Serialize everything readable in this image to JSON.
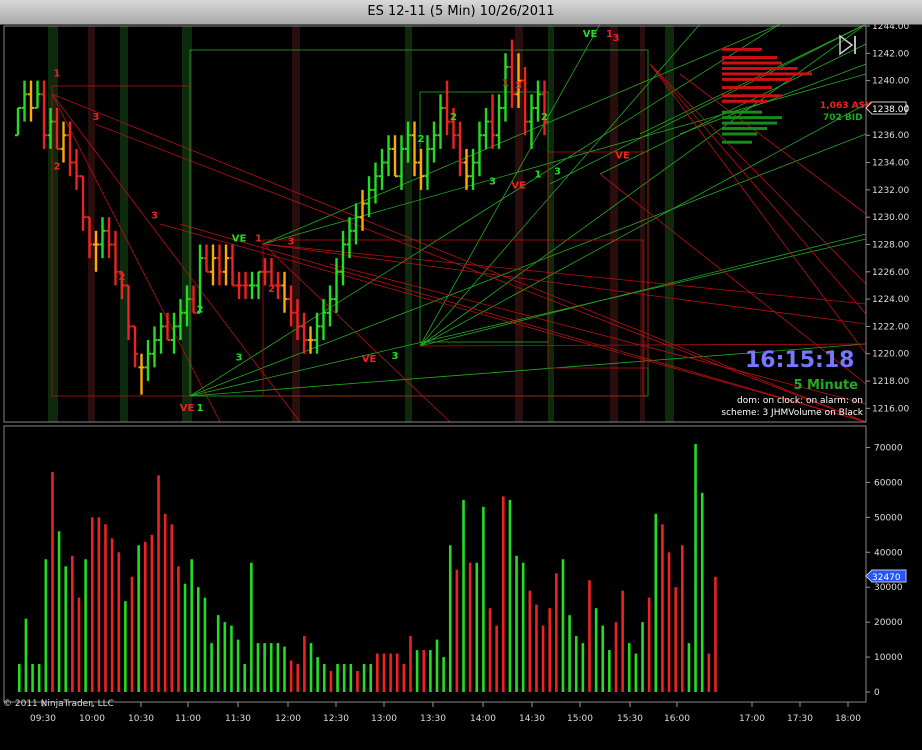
{
  "window": {
    "title": "ES 12-11 (5 Min)  10/26/2011"
  },
  "copyright": "© 2011 NinjaTrader, LLC",
  "clock": {
    "time": "16:15:18",
    "period": "5 Minute"
  },
  "status_lines": [
    "dom: on clock: on alarm: on",
    "scheme: 3 JHMVolume on Black"
  ],
  "dom_labels": {
    "ask": "1,063 ASK",
    "bid": "702 BID"
  },
  "last_price": "1238.00",
  "last_volume": "32470",
  "colors": {
    "up": "#22dd22",
    "down": "#ee2222",
    "neutral": "#ffaa00",
    "background": "#000000",
    "label_last": "#2255ff"
  },
  "chart_data": [
    {
      "type": "candlestick",
      "title": "ES 12-11 (5 Min)  10/26/2011",
      "ylim": [
        1215,
        1244
      ],
      "y_ticks": [
        "1244.00",
        "1242.00",
        "1240.00",
        "1238.00",
        "1236.00",
        "1234.00",
        "1232.00",
        "1230.00",
        "1228.00",
        "1226.00",
        "1224.00",
        "1222.00",
        "1220.00",
        "1218.00",
        "1216.00"
      ],
      "x_ticks": [
        "09:30",
        "10:00",
        "10:30",
        "11:00",
        "11:30",
        "12:00",
        "12:30",
        "13:00",
        "13:30",
        "14:00",
        "14:30",
        "15:00",
        "15:30",
        "16:00",
        "17:00",
        "17:30",
        "18:00"
      ],
      "bars": [
        [
          1236,
          1238,
          1236,
          1238,
          "up"
        ],
        [
          1238,
          1240,
          1237,
          1239,
          "up"
        ],
        [
          1239,
          1240,
          1237,
          1238,
          "neutral"
        ],
        [
          1238,
          1240,
          1238,
          1239,
          "up"
        ],
        [
          1239,
          1240,
          1235,
          1236,
          "down"
        ],
        [
          1236,
          1238,
          1235,
          1237,
          "up"
        ],
        [
          1237,
          1238,
          1235,
          1235,
          "down"
        ],
        [
          1235,
          1237,
          1234,
          1236,
          "neutral"
        ],
        [
          1236,
          1237,
          1233,
          1234,
          "down"
        ],
        [
          1234,
          1235,
          1232,
          1233,
          "down"
        ],
        [
          1233,
          1233,
          1229,
          1230,
          "down"
        ],
        [
          1230,
          1230,
          1227,
          1228,
          "down"
        ],
        [
          1228,
          1229,
          1226,
          1228,
          "neutral"
        ],
        [
          1228,
          1230,
          1227,
          1229,
          "up"
        ],
        [
          1229,
          1230,
          1227,
          1228,
          "down"
        ],
        [
          1228,
          1229,
          1225,
          1226,
          "down"
        ],
        [
          1226,
          1226,
          1224,
          1225,
          "down"
        ],
        [
          1225,
          1225,
          1221,
          1222,
          "down"
        ],
        [
          1222,
          1222,
          1219,
          1220,
          "down"
        ],
        [
          1219,
          1220,
          1217,
          1219,
          "neutral"
        ],
        [
          1219,
          1221,
          1218,
          1220,
          "up"
        ],
        [
          1220,
          1222,
          1219,
          1221,
          "up"
        ],
        [
          1221,
          1223,
          1220,
          1222,
          "up"
        ],
        [
          1222,
          1223,
          1221,
          1221,
          "down"
        ],
        [
          1221,
          1223,
          1220,
          1222,
          "up"
        ],
        [
          1222,
          1224,
          1221,
          1223,
          "up"
        ],
        [
          1223,
          1225,
          1222,
          1224,
          "up"
        ],
        [
          1224,
          1225,
          1223,
          1223,
          "down"
        ],
        [
          1223,
          1228,
          1223,
          1227,
          "up"
        ],
        [
          1227,
          1228,
          1226,
          1226,
          "down"
        ],
        [
          1226,
          1228,
          1225,
          1227,
          "neutral"
        ],
        [
          1227,
          1228,
          1225,
          1226,
          "down"
        ],
        [
          1226,
          1228,
          1225,
          1227,
          "neutral"
        ],
        [
          1227,
          1228,
          1225,
          1225,
          "down"
        ],
        [
          1225,
          1226,
          1224,
          1225,
          "down"
        ],
        [
          1225,
          1226,
          1224,
          1225,
          "down"
        ],
        [
          1225,
          1226,
          1224,
          1225,
          "up"
        ],
        [
          1225,
          1226,
          1224,
          1226,
          "up"
        ],
        [
          1226,
          1227,
          1225,
          1226,
          "down"
        ],
        [
          1226,
          1227,
          1225,
          1225,
          "down"
        ],
        [
          1225,
          1226,
          1224,
          1225,
          "down"
        ],
        [
          1225,
          1226,
          1223,
          1224,
          "neutral"
        ],
        [
          1224,
          1225,
          1222,
          1223,
          "down"
        ],
        [
          1223,
          1224,
          1221,
          1222,
          "down"
        ],
        [
          1222,
          1223,
          1220,
          1221,
          "down"
        ],
        [
          1221,
          1222,
          1220,
          1221,
          "neutral"
        ],
        [
          1221,
          1223,
          1220,
          1222,
          "up"
        ],
        [
          1222,
          1224,
          1221,
          1223,
          "up"
        ],
        [
          1223,
          1225,
          1222,
          1224,
          "up"
        ],
        [
          1224,
          1227,
          1223,
          1226,
          "up"
        ],
        [
          1226,
          1229,
          1225,
          1228,
          "up"
        ],
        [
          1228,
          1230,
          1227,
          1229,
          "up"
        ],
        [
          1229,
          1231,
          1228,
          1230,
          "up"
        ],
        [
          1230,
          1232,
          1229,
          1231,
          "neutral"
        ],
        [
          1231,
          1233,
          1230,
          1232,
          "up"
        ],
        [
          1232,
          1234,
          1231,
          1233,
          "up"
        ],
        [
          1233,
          1235,
          1232,
          1234,
          "up"
        ],
        [
          1234,
          1236,
          1233,
          1235,
          "up"
        ],
        [
          1235,
          1236,
          1233,
          1233,
          "neutral"
        ],
        [
          1233,
          1236,
          1232,
          1235,
          "up"
        ],
        [
          1235,
          1237,
          1234,
          1236,
          "up"
        ],
        [
          1236,
          1237,
          1233,
          1234,
          "neutral"
        ],
        [
          1234,
          1235,
          1232,
          1233,
          "neutral"
        ],
        [
          1233,
          1236,
          1232,
          1235,
          "up"
        ],
        [
          1235,
          1237,
          1234,
          1236,
          "up"
        ],
        [
          1236,
          1239,
          1235,
          1238,
          "up"
        ],
        [
          1238,
          1240,
          1236,
          1237,
          "down"
        ],
        [
          1237,
          1238,
          1235,
          1236,
          "down"
        ],
        [
          1236,
          1237,
          1233,
          1234,
          "down"
        ],
        [
          1234,
          1235,
          1232,
          1233,
          "neutral"
        ],
        [
          1233,
          1235,
          1232,
          1234,
          "up"
        ],
        [
          1234,
          1237,
          1233,
          1236,
          "up"
        ],
        [
          1236,
          1238,
          1235,
          1237,
          "up"
        ],
        [
          1237,
          1239,
          1235,
          1236,
          "down"
        ],
        [
          1236,
          1239,
          1235,
          1238,
          "up"
        ],
        [
          1238,
          1242,
          1237,
          1241,
          "up"
        ],
        [
          1241,
          1243,
          1238,
          1239,
          "down"
        ],
        [
          1239,
          1242,
          1238,
          1240,
          "neutral"
        ],
        [
          1240,
          1241,
          1236,
          1237,
          "down"
        ],
        [
          1237,
          1239,
          1235,
          1238,
          "up"
        ],
        [
          1238,
          1240,
          1237,
          1239,
          "up"
        ],
        [
          1239,
          1240,
          1236,
          1237,
          "down"
        ]
      ]
    },
    {
      "type": "bar",
      "title": "Volume",
      "ylim": [
        0,
        75000
      ],
      "y_ticks": [
        "70000",
        "60000",
        "50000",
        "40000",
        "30000",
        "20000",
        "10000",
        "0"
      ],
      "values": [
        [
          8000,
          "up"
        ],
        [
          21000,
          "up"
        ],
        [
          8000,
          "up"
        ],
        [
          8000,
          "up"
        ],
        [
          38000,
          "up"
        ],
        [
          63000,
          "down"
        ],
        [
          46000,
          "up"
        ],
        [
          36000,
          "up"
        ],
        [
          39000,
          "down"
        ],
        [
          27000,
          "down"
        ],
        [
          38000,
          "up"
        ],
        [
          50000,
          "down"
        ],
        [
          50000,
          "down"
        ],
        [
          48000,
          "down"
        ],
        [
          44000,
          "down"
        ],
        [
          40000,
          "down"
        ],
        [
          26000,
          "up"
        ],
        [
          33000,
          "down"
        ],
        [
          42000,
          "up"
        ],
        [
          43000,
          "down"
        ],
        [
          45000,
          "down"
        ],
        [
          62000,
          "down"
        ],
        [
          51000,
          "down"
        ],
        [
          48000,
          "down"
        ],
        [
          36000,
          "down"
        ],
        [
          31000,
          "up"
        ],
        [
          38000,
          "up"
        ],
        [
          30000,
          "up"
        ],
        [
          27000,
          "up"
        ],
        [
          14000,
          "up"
        ],
        [
          22000,
          "up"
        ],
        [
          20000,
          "up"
        ],
        [
          19000,
          "up"
        ],
        [
          15000,
          "up"
        ],
        [
          8000,
          "up"
        ],
        [
          37000,
          "up"
        ],
        [
          14000,
          "up"
        ],
        [
          14000,
          "up"
        ],
        [
          14000,
          "up"
        ],
        [
          14000,
          "up"
        ],
        [
          13000,
          "up"
        ],
        [
          9000,
          "down"
        ],
        [
          8000,
          "down"
        ],
        [
          16000,
          "down"
        ],
        [
          14000,
          "up"
        ],
        [
          10000,
          "up"
        ],
        [
          8000,
          "up"
        ],
        [
          6000,
          "down"
        ],
        [
          8000,
          "up"
        ],
        [
          8000,
          "up"
        ],
        [
          8000,
          "up"
        ],
        [
          6000,
          "down"
        ],
        [
          8000,
          "up"
        ],
        [
          8000,
          "up"
        ],
        [
          11000,
          "down"
        ],
        [
          11000,
          "down"
        ],
        [
          11000,
          "down"
        ],
        [
          11000,
          "down"
        ],
        [
          8000,
          "down"
        ],
        [
          16000,
          "down"
        ],
        [
          12000,
          "up"
        ],
        [
          12000,
          "down"
        ],
        [
          12000,
          "up"
        ],
        [
          15000,
          "up"
        ],
        [
          10000,
          "up"
        ],
        [
          42000,
          "up"
        ],
        [
          35000,
          "down"
        ],
        [
          55000,
          "up"
        ],
        [
          37000,
          "down"
        ],
        [
          37000,
          "up"
        ],
        [
          53000,
          "up"
        ],
        [
          24000,
          "down"
        ],
        [
          19000,
          "down"
        ],
        [
          56000,
          "down"
        ],
        [
          55000,
          "up"
        ],
        [
          39000,
          "up"
        ],
        [
          37000,
          "up"
        ],
        [
          29000,
          "down"
        ],
        [
          25000,
          "down"
        ],
        [
          19000,
          "down"
        ],
        [
          24000,
          "down"
        ],
        [
          34000,
          "down"
        ],
        [
          38000,
          "up"
        ],
        [
          22000,
          "up"
        ],
        [
          16000,
          "up"
        ],
        [
          14000,
          "up"
        ],
        [
          32000,
          "down"
        ],
        [
          24000,
          "up"
        ],
        [
          19000,
          "up"
        ],
        [
          12000,
          "up"
        ],
        [
          20000,
          "down"
        ],
        [
          29000,
          "down"
        ],
        [
          14000,
          "up"
        ],
        [
          11000,
          "up"
        ],
        [
          20000,
          "up"
        ],
        [
          27000,
          "down"
        ],
        [
          51000,
          "up"
        ],
        [
          48000,
          "down"
        ],
        [
          40000,
          "down"
        ],
        [
          30000,
          "down"
        ],
        [
          42000,
          "down"
        ],
        [
          14000,
          "up"
        ],
        [
          71000,
          "up"
        ],
        [
          57000,
          "up"
        ],
        [
          11000,
          "down"
        ],
        [
          33000,
          "down"
        ]
      ]
    }
  ],
  "annotations": [
    {
      "text": "1",
      "color": "down",
      "bar": 6,
      "price": 1240.6
    },
    {
      "text": "2",
      "color": "down",
      "bar": 6,
      "price": 1233.8
    },
    {
      "text": "3",
      "color": "down",
      "bar": 12,
      "price": 1237.4
    },
    {
      "text": "2",
      "color": "down",
      "bar": 16,
      "price": 1225.7
    },
    {
      "text": "3",
      "color": "down",
      "bar": 21,
      "price": 1230.2
    },
    {
      "text": "VE",
      "color": "down",
      "bar": 26,
      "price": 1216.1
    },
    {
      "text": "1",
      "color": "up",
      "bar": 28,
      "price": 1216.1
    },
    {
      "text": "2",
      "color": "up",
      "bar": 28,
      "price": 1223.3
    },
    {
      "text": "3",
      "color": "up",
      "bar": 34,
      "price": 1219.8
    },
    {
      "text": "VE",
      "color": "up",
      "bar": 34,
      "price": 1228.5
    },
    {
      "text": "1",
      "color": "down",
      "bar": 37,
      "price": 1228.5
    },
    {
      "text": "2",
      "color": "down",
      "bar": 39,
      "price": 1224.8
    },
    {
      "text": "3",
      "color": "down",
      "bar": 42,
      "price": 1228.3
    },
    {
      "text": "VE",
      "color": "down",
      "bar": 54,
      "price": 1219.7
    },
    {
      "text": "3",
      "color": "up",
      "bar": 58,
      "price": 1219.9
    },
    {
      "text": "2",
      "color": "up",
      "bar": 62,
      "price": 1235.8
    },
    {
      "text": "2",
      "color": "up",
      "bar": 67,
      "price": 1237.4
    },
    {
      "text": "3",
      "color": "up",
      "bar": 73,
      "price": 1232.7
    },
    {
      "text": "1",
      "color": "down",
      "bar": 75,
      "price": 1239.9
    },
    {
      "text": "3",
      "color": "down",
      "bar": 77,
      "price": 1239.7
    },
    {
      "text": "VE",
      "color": "down",
      "bar": 77,
      "price": 1232.4
    },
    {
      "text": "1",
      "color": "up",
      "bar": 80,
      "price": 1233.2
    },
    {
      "text": "2",
      "color": "up",
      "bar": 81,
      "price": 1237.4
    },
    {
      "text": "3",
      "color": "up",
      "bar": 83,
      "price": 1233.4
    },
    {
      "text": "VE",
      "color": "up",
      "bar": 88,
      "price": 1243.5
    },
    {
      "text": "1",
      "color": "down",
      "bar": 91,
      "price": 1243.5
    },
    {
      "text": "3",
      "color": "down",
      "bar": 92,
      "price": 1243.2
    },
    {
      "text": "VE",
      "color": "down",
      "bar": 93,
      "price": 1234.6
    }
  ]
}
